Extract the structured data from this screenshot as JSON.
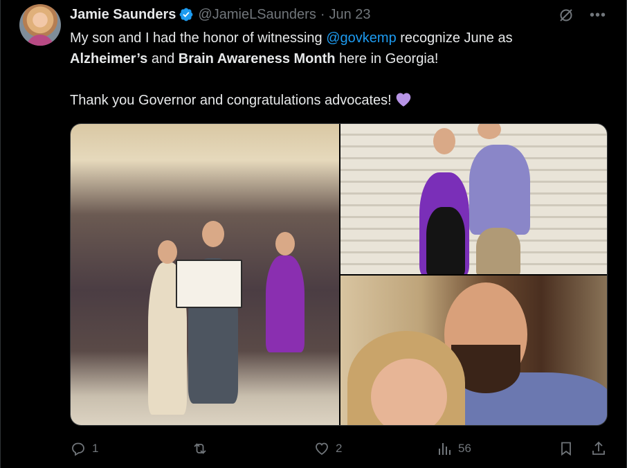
{
  "author": {
    "name": "Jamie Saunders",
    "handle": "@JamieLSaunders",
    "separator": "·",
    "date": "Jun 23"
  },
  "tweet": {
    "line1_a": "My son and I had the honor of witnessing ",
    "mention": "@govkemp",
    "line1_b": " recognize June as",
    "bold1": "Alzheimer’s",
    "and": " and ",
    "bold2": "Brain Awareness Month",
    "line2_b": " here in Georgia!",
    "line3": "Thank you Governor and congratulations advocates!",
    "emoji": "purple-heart"
  },
  "media": {
    "photos": [
      "group-photo-proclamation",
      "stairs-photo",
      "selfie-photo"
    ]
  },
  "actions": {
    "replies": "1",
    "reposts": "",
    "likes": "2",
    "views": "56"
  },
  "colors": {
    "accent": "#1d9bf0",
    "muted": "#71767b",
    "background": "#000000",
    "heart": "#b794e6"
  }
}
